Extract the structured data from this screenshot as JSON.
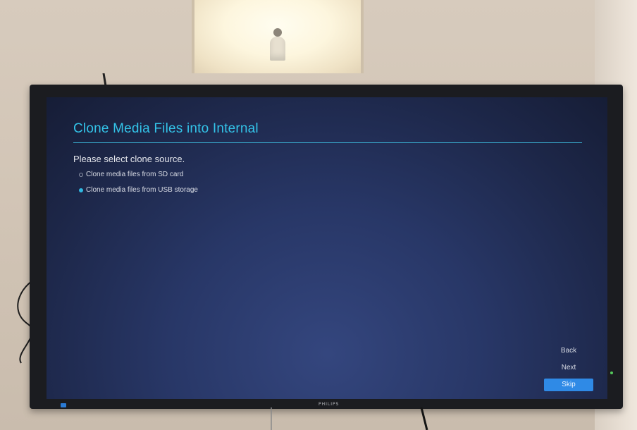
{
  "screen": {
    "title": "Clone Media Files into Internal",
    "prompt": "Please select clone source.",
    "options": [
      {
        "label": "Clone media files from SD card",
        "selected": false
      },
      {
        "label": "Clone media files from USB storage",
        "selected": true
      }
    ],
    "buttons": {
      "back": "Back",
      "next": "Next",
      "skip": "Skip"
    }
  },
  "bezel": {
    "brand": "PHILIPS"
  },
  "colors": {
    "accent": "#33c3e8",
    "button_primary": "#2f8ae6",
    "screen_bg": "#283767"
  }
}
